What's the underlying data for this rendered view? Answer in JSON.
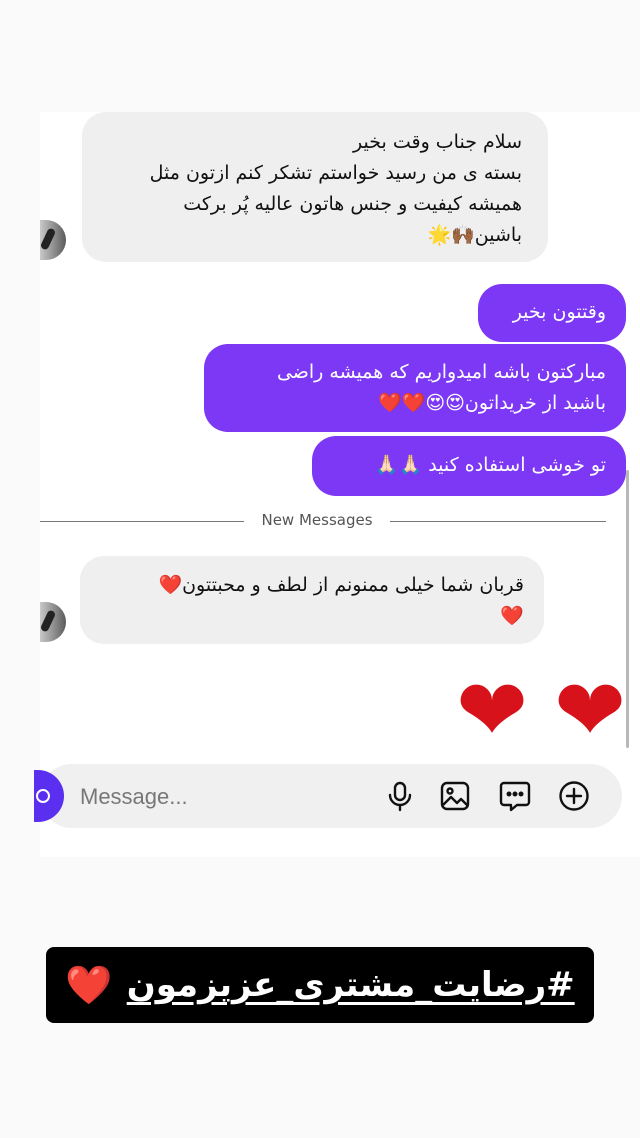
{
  "chat": {
    "messages": [
      {
        "side": "incoming",
        "lines": [
          "سلام جناب وقت بخیر",
          "بسته ی من رسید خواستم تشکر کنم ازتون مثل",
          "همیشه کیفیت و جنس هاتون عالیه پُر برکت",
          "باشین🙌🏾🌟"
        ]
      },
      {
        "side": "outgoing",
        "lines": [
          "وقتتون بخیر"
        ]
      },
      {
        "side": "outgoing",
        "lines": [
          "مبارکتون باشه امیدواریم که همیشه راضی",
          "باشید از خریداتون😍😍❤️❤️"
        ]
      },
      {
        "side": "outgoing",
        "lines": [
          "تو خوشی استفاده کنید 🙏🏻🙏🏻"
        ]
      },
      {
        "side": "incoming",
        "lines": [
          "قربان شما خیلی ممنونم از لطف و محبتتون❤️",
          "❤️"
        ]
      }
    ],
    "new_messages_label": "New Messages",
    "big_hearts": [
      "❤",
      "❤"
    ]
  },
  "composer": {
    "placeholder": "Message...",
    "icons": [
      "camera-icon",
      "microphone-icon",
      "gallery-icon",
      "sticker-icon",
      "add-icon"
    ]
  },
  "banner": {
    "hashtag": "#رضایت_مشتری_عزیزمون",
    "heart": "❤️"
  },
  "colors": {
    "outgoing_bubble": "#7c38f4",
    "incoming_bubble": "#efefef",
    "heart": "#e0201e",
    "camera_button": "#5b2ff0"
  }
}
